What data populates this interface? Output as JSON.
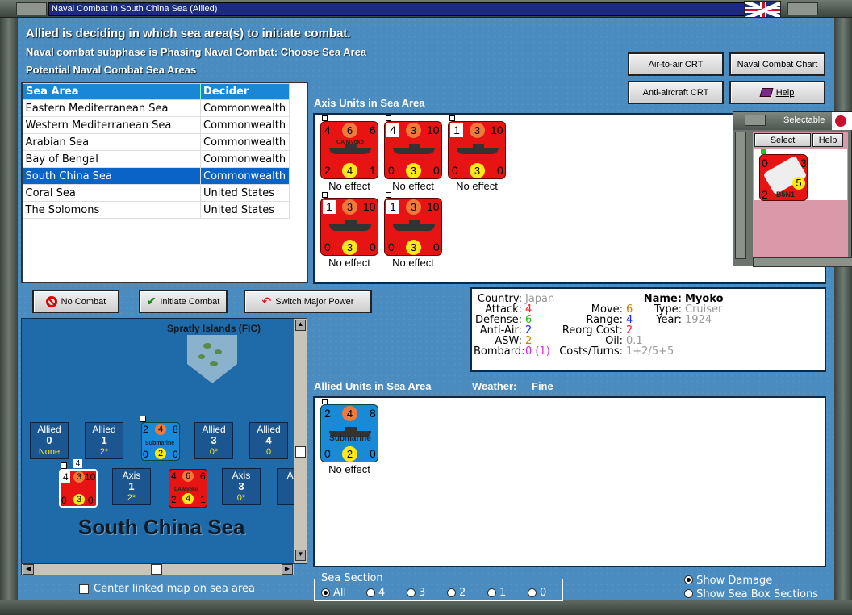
{
  "window": {
    "title": "Naval Combat In South China Sea (Allied)"
  },
  "header": {
    "line1": "Allied is deciding in which sea area(s) to initiate combat.",
    "line2": "Naval combat subphase is Phasing Naval Combat: Choose Sea Area",
    "line3": "Potential Naval Combat Sea Areas"
  },
  "toolbar": {
    "air_crt": "Air-to-air CRT",
    "naval_chart": "Naval Combat Chart",
    "aa_crt": "Anti-aircraft CRT",
    "help": "Help"
  },
  "sea_table": {
    "headers": [
      "Sea Area",
      "Decider"
    ],
    "rows": [
      [
        "Eastern Mediterranean Sea",
        "Commonwealth"
      ],
      [
        "Western Mediterranean Sea",
        "Commonwealth"
      ],
      [
        "Arabian Sea",
        "Commonwealth"
      ],
      [
        "Bay of Bengal",
        "Commonwealth"
      ],
      [
        "South China Sea",
        "Commonwealth"
      ],
      [
        "Coral Sea",
        "United States"
      ],
      [
        "The Solomons",
        "United States"
      ]
    ],
    "selected_index": 4
  },
  "axis_units": {
    "label": "Axis Units in Sea Area",
    "units": [
      {
        "tl": "4",
        "tc": "6",
        "tr": "6",
        "name": "CA Myoko",
        "bl": "2",
        "bc": "4",
        "br": "1",
        "effect": "No effect",
        "box": ""
      },
      {
        "tl": "4",
        "tc": "3",
        "tr": "10",
        "name": "",
        "bl": "0",
        "bc": "3",
        "br": "0",
        "effect": "No effect",
        "box": "4"
      },
      {
        "tl": "1",
        "tc": "3",
        "tr": "10",
        "name": "",
        "bl": "0",
        "bc": "3",
        "br": "0",
        "effect": "No effect",
        "box": "1"
      },
      {
        "tl": "1",
        "tc": "3",
        "tr": "10",
        "name": "",
        "bl": "0",
        "bc": "3",
        "br": "0",
        "effect": "No effect",
        "box": "1"
      },
      {
        "tl": "1",
        "tc": "3",
        "tr": "10",
        "name": "",
        "bl": "0",
        "bc": "3",
        "br": "0",
        "effect": "No effect",
        "box": "1"
      }
    ]
  },
  "selectable": {
    "title": "Selectable",
    "select": "Select",
    "help": "Help",
    "unit": {
      "tl": "0",
      "tr": "3",
      "bl": "2",
      "bc": "5",
      "name": "B5N1"
    }
  },
  "actions": {
    "no_combat": "No Combat",
    "initiate": "Initiate Combat",
    "switch": "Switch Major Power"
  },
  "map": {
    "island": "Spratly Islands (FIC)",
    "sea_name": "South China Sea",
    "allied_boxes": [
      {
        "label": "Allied",
        "num": "0",
        "sub": "None"
      },
      {
        "label": "Allied",
        "num": "1",
        "sub": "2*"
      },
      {
        "label": "Allied",
        "num": "3",
        "sub": "0*"
      },
      {
        "label": "Allied",
        "num": "4",
        "sub": "0"
      }
    ],
    "axis_boxes": [
      {
        "label": "Axis",
        "num": "1",
        "sub": "2*"
      },
      {
        "label": "Axis",
        "num": "3",
        "sub": "0*"
      },
      {
        "label": "Axis",
        "num": "",
        "sub": ""
      }
    ],
    "stack_badge": "4",
    "sub_counter": {
      "tl": "2",
      "tc": "4",
      "tr": "8",
      "name": "Submarine",
      "bl": "0",
      "bc": "2",
      "br": "0"
    },
    "axis_counter": {
      "tl": "4",
      "tc": "3",
      "tr": "10",
      "bl": "0",
      "bc": "3",
      "br": "0"
    },
    "myoko_counter": {
      "tl": "4",
      "tc": "6",
      "tr": "6",
      "name": "CA Myoko",
      "bl": "2",
      "bc": "4",
      "br": "1"
    }
  },
  "center_map": "Center linked map on sea area",
  "info": {
    "country_l": "Country:",
    "country_v": "Japan",
    "attack_l": "Attack:",
    "attack_v": "4",
    "defense_l": "Defense:",
    "defense_v": "6",
    "aa_l": "Anti-Air:",
    "aa_v": "2",
    "asw_l": "ASW:",
    "asw_v": "2",
    "bombard_l": "Bombard:",
    "bombard_v": "0 (1)",
    "name_l": "Name:",
    "name_v": "Myoko",
    "type_l": "Type:",
    "type_v": "Cruiser",
    "year_l": "Year:",
    "year_v": "1924",
    "move_l": "Move:",
    "move_v": "6",
    "range_l": "Range:",
    "range_v": "4",
    "reorg_l": "Reorg Cost:",
    "reorg_v": "2",
    "oil_l": "Oil:",
    "oil_v": "0.1",
    "cost_l": "Costs/Turns:",
    "cost_v": "1+2/5+5"
  },
  "allied_units": {
    "label": "Allied Units in Sea Area",
    "weather_l": "Weather:",
    "weather_v": "Fine",
    "units": [
      {
        "tl": "2",
        "tc": "4",
        "tr": "8",
        "name": "Submarine",
        "bl": "0",
        "bc": "2",
        "br": "0",
        "effect": "No effect"
      }
    ]
  },
  "sea_section": {
    "title": "Sea Section",
    "options": [
      "All",
      "4",
      "3",
      "2",
      "1",
      "0"
    ],
    "selected": "All"
  },
  "display": {
    "show_damage": "Show Damage",
    "show_sections": "Show Sea Box Sections",
    "selected": "Show Damage"
  },
  "colors": {
    "attack": "#ff2020",
    "defense": "#20c020",
    "aa": "#2020ff",
    "asw": "#d08000",
    "bombard": "#e020e0",
    "move": "#d08000",
    "range": "#2020ff",
    "reorg": "#ff2020",
    "grey": "#9a9a9a"
  }
}
